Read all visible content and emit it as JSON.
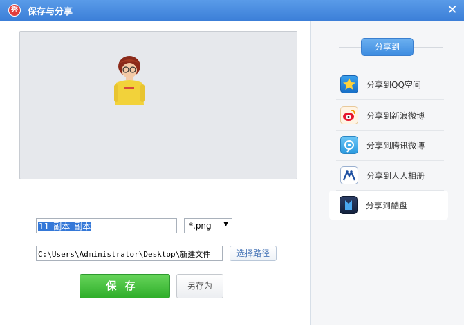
{
  "window": {
    "title": "保存与分享",
    "app_icon_text": "秀",
    "close_glyph": "✕"
  },
  "save": {
    "filename_value": "11_副本_副本",
    "format_value": "*.png",
    "path_value": "C:\\Users\\Administrator\\Desktop\\新建文件",
    "choose_path_label": "选择路径",
    "save_label": "保存",
    "save_as_label": "另存为"
  },
  "share": {
    "header": "分享到",
    "items": [
      {
        "label": "分享到QQ空间",
        "icon": "qzone-icon"
      },
      {
        "label": "分享到新浪微博",
        "icon": "sina-weibo-icon"
      },
      {
        "label": "分享到腾讯微博",
        "icon": "tencent-weibo-icon"
      },
      {
        "label": "分享到人人相册",
        "icon": "renren-icon"
      },
      {
        "label": "分享到酷盘",
        "icon": "kupan-icon"
      }
    ]
  },
  "colors": {
    "title_bar": "#4a8ee0",
    "save_button": "#3cb832",
    "share_header": "#4a96e6"
  }
}
